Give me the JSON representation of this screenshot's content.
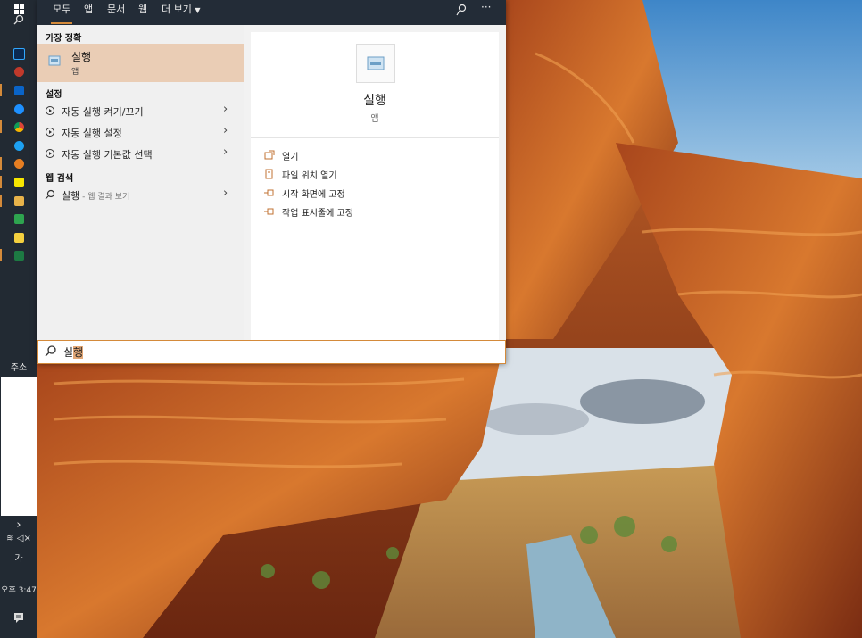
{
  "colors": {
    "accent": "#d48a3a",
    "selected_bg": "#eacdb5",
    "taskbar": "#222a33"
  },
  "tabs": [
    {
      "label": "모두",
      "selected": true
    },
    {
      "label": "앱"
    },
    {
      "label": "문서"
    },
    {
      "label": "웹"
    },
    {
      "label": "더 보기"
    }
  ],
  "tab_icons": [
    "feedback-icon",
    "more-icon"
  ],
  "left": {
    "best_match_header": "가장 정확",
    "best_match": {
      "title": "실행",
      "subtitle": "앱"
    },
    "settings_header": "설정",
    "settings_items": [
      {
        "label": "자동 실행 켜기/끄기"
      },
      {
        "label": "자동 실행 설정"
      },
      {
        "label": "자동 실행 기본값 선택"
      }
    ],
    "web_header": "웹 검색",
    "web_item": {
      "label": "실행",
      "suffix": " - 웹 결과 보기"
    }
  },
  "detail": {
    "title": "실행",
    "subtitle": "앱",
    "actions": [
      {
        "label": "열기",
        "icon": "open-icon"
      },
      {
        "label": "파일 위치 열기",
        "icon": "file-location-icon"
      },
      {
        "label": "시작 화면에 고정",
        "icon": "pin-icon"
      },
      {
        "label": "작업 표시줄에 고정",
        "icon": "pin-icon"
      }
    ]
  },
  "search": {
    "typed": "실",
    "suggested": "행"
  },
  "taskbar": {
    "address_label": "주소",
    "volume": "◁×",
    "ime": "가",
    "clock": "오후 3:47"
  }
}
